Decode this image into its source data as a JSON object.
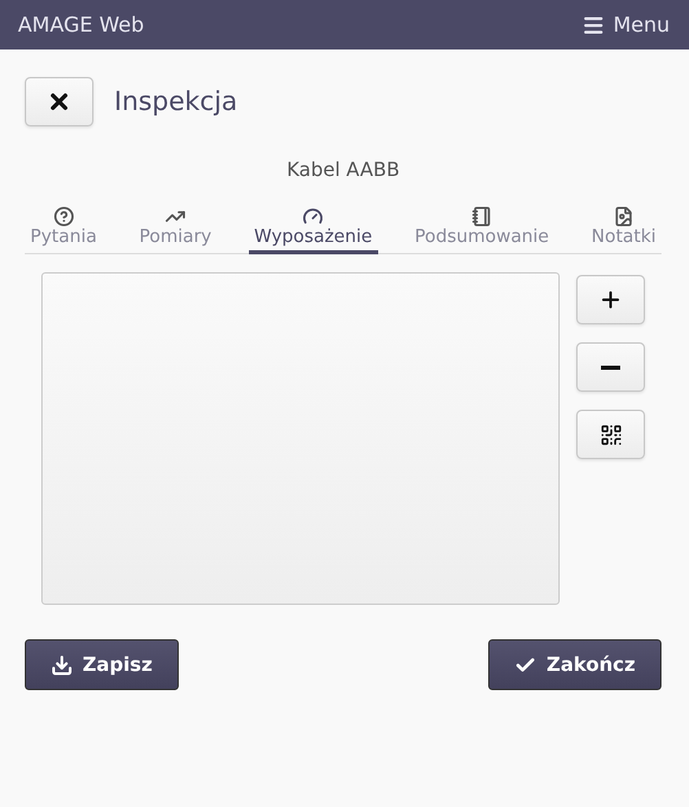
{
  "navbar": {
    "brand": "AMAGE Web",
    "menu": "Menu"
  },
  "header": {
    "title": "Inspekcja"
  },
  "subject": "Kabel AABB",
  "tabs": [
    {
      "label": "Pytania",
      "selected": false
    },
    {
      "label": "Pomiary",
      "selected": false
    },
    {
      "label": "Wyposażenie",
      "selected": true
    },
    {
      "label": "Podsumowanie",
      "selected": false
    },
    {
      "label": "Notatki",
      "selected": false
    }
  ],
  "footer": {
    "save": "Zapisz",
    "finish": "Zakończ"
  }
}
